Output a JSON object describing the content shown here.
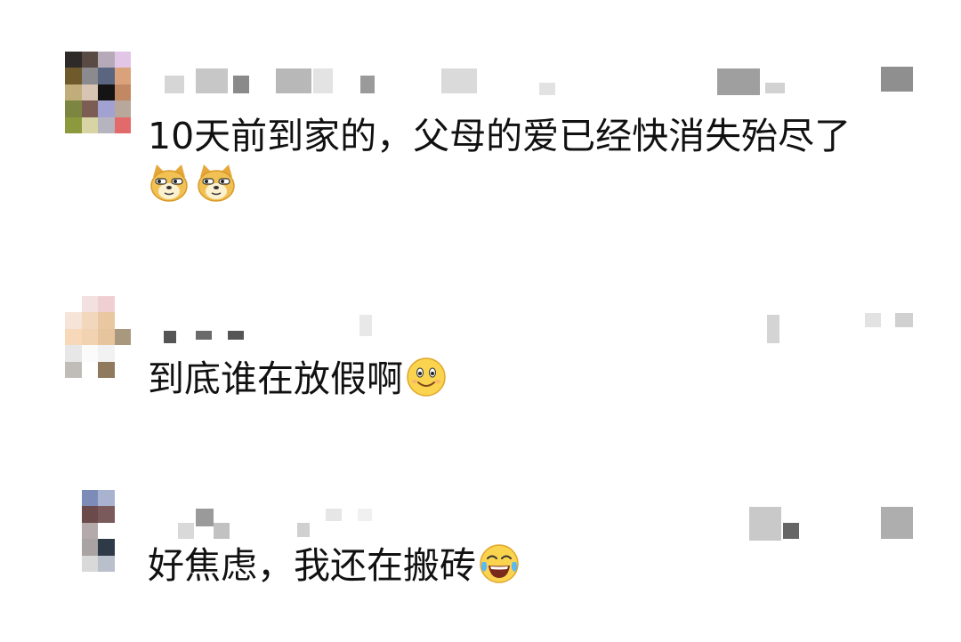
{
  "comments": [
    {
      "text": "10天前到家的，父母的爱已经快消失殆尽了",
      "emoji": [
        "doge-emoji",
        "doge-emoji"
      ]
    },
    {
      "text": "到底谁在放假啊",
      "emoji": [
        "smile-emoji"
      ]
    },
    {
      "text": "好焦虑，我还在搬砖",
      "emoji": [
        "tears-of-joy-emoji"
      ]
    }
  ]
}
